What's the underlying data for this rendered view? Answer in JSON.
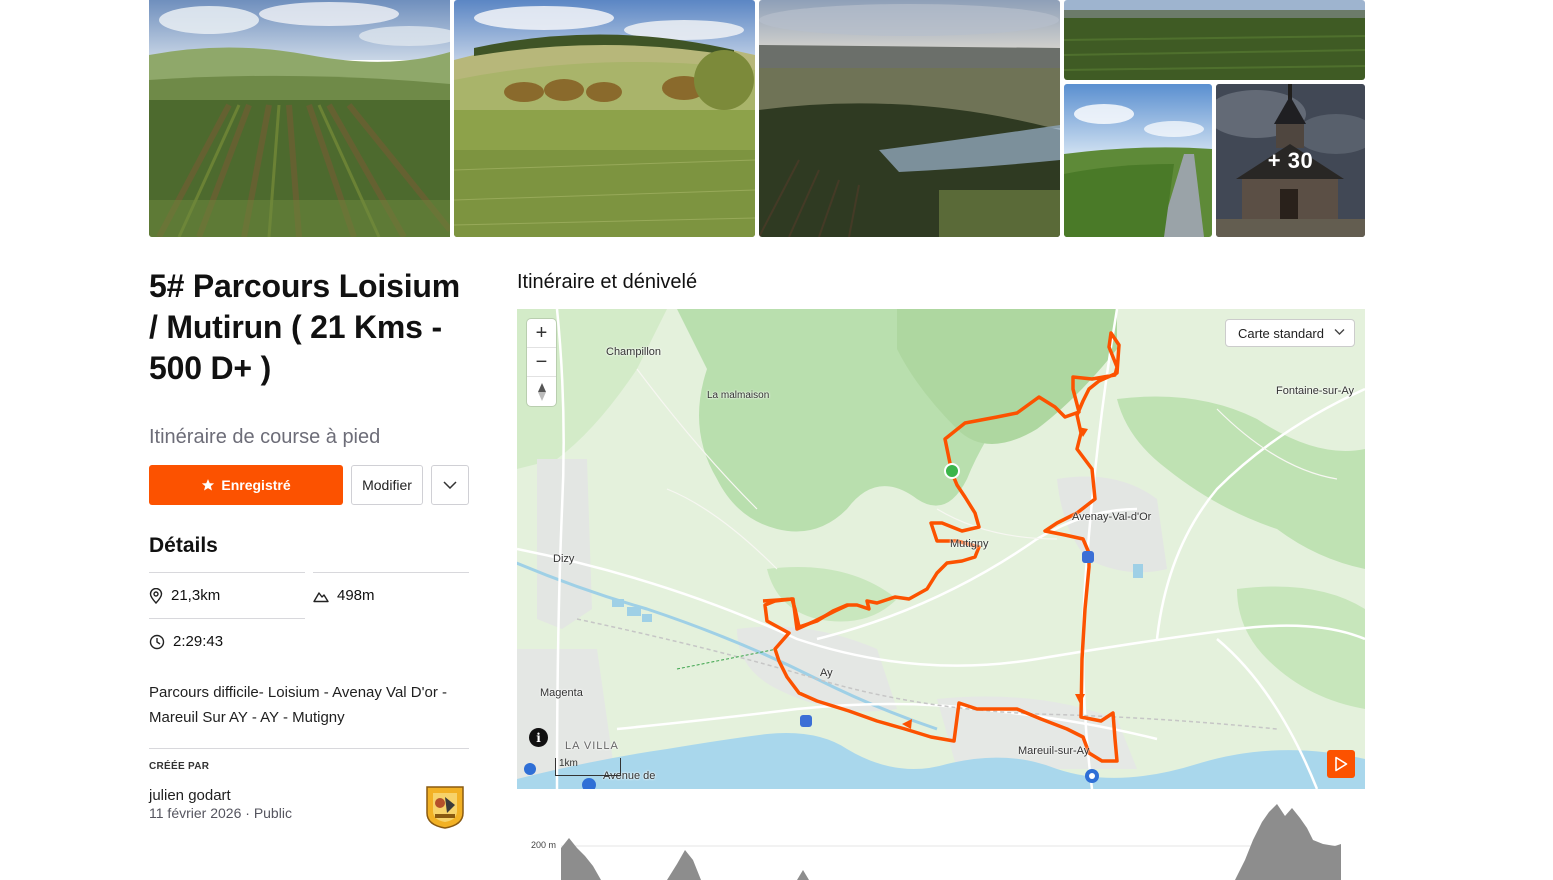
{
  "gallery": {
    "more_count_label": "+ 30"
  },
  "route": {
    "title": "5# Parcours Loisium / Mutirun ( 21 Kms - 500 D+ )",
    "subtitle": "Itinéraire de course à pied",
    "saved_label": "Enregistré",
    "edit_label": "Modifier"
  },
  "details": {
    "heading": "Détails",
    "distance": "21,3km",
    "elevation": "498m",
    "duration": "2:29:43",
    "description": "Parcours difficile- Loisium - Avenay Val D'or - Mareuil Sur AY - AY - Mutigny"
  },
  "creator": {
    "label": "CRÉÉE PAR",
    "name": "julien godart",
    "date": "11 février 2026",
    "visibility": "Public"
  },
  "map": {
    "heading": "Itinéraire et dénivelé",
    "map_type": "Carte standard",
    "zoom_in": "+",
    "zoom_out": "−",
    "scale_label": "1km",
    "info": "i",
    "route_color": "#fc5200",
    "places": {
      "champillon": "Champillon",
      "la_malmaison": "La malmaison",
      "fontaine": "Fontaine-sur-Ay",
      "avenay": "Avenay-Val-d'Or",
      "mutigny": "Mutigny",
      "dizy": "Dizy",
      "ay": "Ay",
      "magenta": "Magenta",
      "la_villa": "LA VILLA",
      "mareuil": "Mareuil-sur-Ay",
      "avenue": "Avenue de"
    }
  },
  "elevation_chart": {
    "y_label": "200 m"
  },
  "colors": {
    "accent": "#fc5200",
    "text": "#111111",
    "muted": "#6d6d78"
  }
}
